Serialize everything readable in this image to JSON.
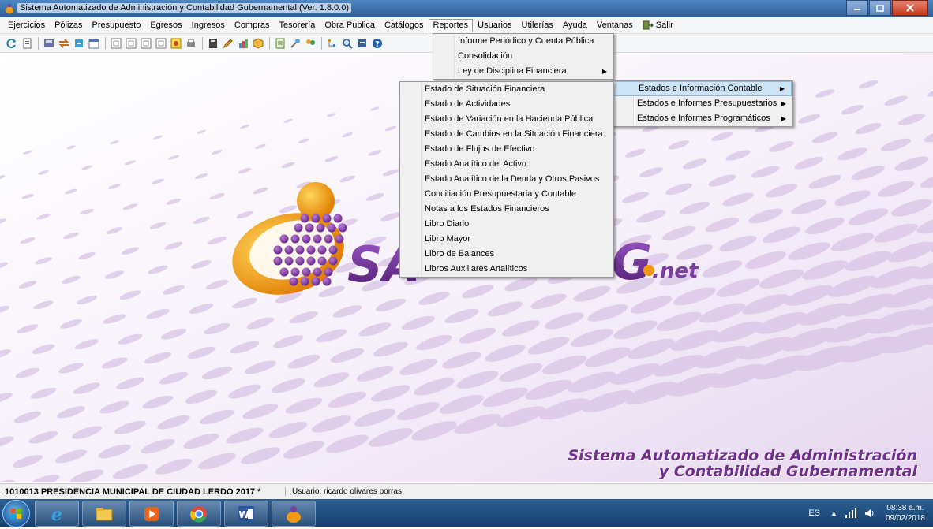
{
  "window": {
    "title": "Sistema Automatizado de Administración y Contabilidad Gubernamental  (Ver. 1.8.0.0)"
  },
  "menubar": {
    "items": [
      "Ejercicios",
      "Pólizas",
      "Presupuesto",
      "Egresos",
      "Ingresos",
      "Compras",
      "Tesorería",
      "Obra Publica",
      "Catálogos",
      "Reportes",
      "Usuarios",
      "Utilerías",
      "Ayuda",
      "Ventanas",
      "Salir"
    ],
    "open_item": "Reportes"
  },
  "reportes_menu": {
    "items": [
      {
        "label": "Informe Periódico y Cuenta Pública"
      },
      {
        "label": "Consolidación"
      },
      {
        "label": "Ley de Disciplina Financiera",
        "submenu": true
      }
    ]
  },
  "estados_menu": {
    "items": [
      {
        "label": "Estados e Información Contable",
        "submenu": true,
        "highlighted": true
      },
      {
        "label": "Estados e Informes Presupuestarios",
        "submenu": true
      },
      {
        "label": "Estados e Informes Programáticos",
        "submenu": true
      }
    ]
  },
  "contable_menu": {
    "items": [
      "Estado de Situación Financiera",
      "Estado de Actividades",
      "Estado de Variación en la Hacienda Pública",
      "Estado de Cambios en la Situación Financiera",
      "Estado de Flujos de Efectivo",
      "Estado Analítico del Activo",
      "Estado Analítico de la Deuda y Otros Pasivos",
      "Conciliación Presupuestaria y Contable",
      "Notas a los Estados Financieros",
      "Libro Diario",
      "Libro Mayor",
      "Libro de Balances",
      "Libros Auxiliares Analíticos"
    ]
  },
  "branding": {
    "logo_letters_left": "SA",
    "logo_letters_right": "G",
    "logo_suffix": ".net",
    "tagline_line1": "Sistema Automatizado de Administración",
    "tagline_line2": "y Contabilidad Gubernamental"
  },
  "statusbar": {
    "organization": "1010013 PRESIDENCIA MUNICIPAL DE CIUDAD LERDO  2017   *",
    "user": "Usuario: ricardo olivares porras"
  },
  "taskbar": {
    "language": "ES",
    "time": "08:38 a.m.",
    "date": "09/02/2018",
    "apps": [
      "internet-explorer",
      "file-explorer",
      "media-player",
      "chrome",
      "word",
      "sacg-app"
    ]
  },
  "colors": {
    "accent": "#7b3fa0",
    "logo_orange": "#f29a16",
    "menu_highlight": "#cde3f6",
    "taskbar": "#1d4b7c"
  }
}
